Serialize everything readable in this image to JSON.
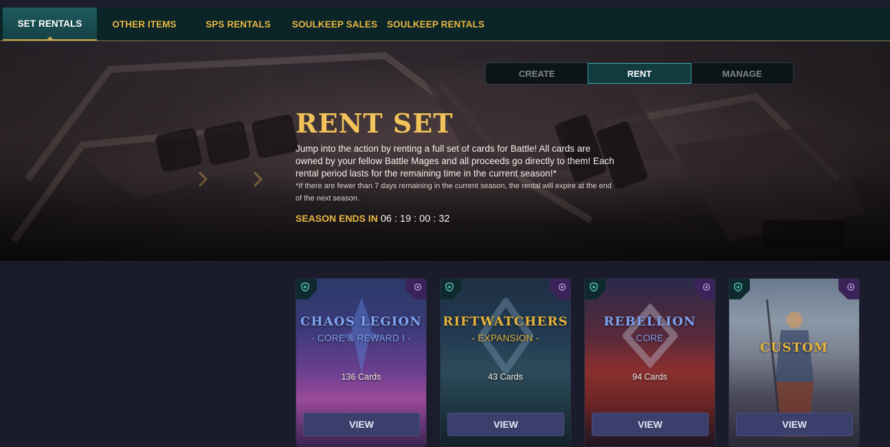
{
  "nav": {
    "tabs": [
      {
        "label": "SET RENTALS",
        "active": true
      },
      {
        "label": "OTHER ITEMS"
      },
      {
        "label": "SPS RENTALS"
      },
      {
        "label": "SOULKEEP SALES"
      },
      {
        "label": "SOULKEEP RENTALS"
      }
    ]
  },
  "mode_switch": {
    "options": [
      {
        "label": "CREATE"
      },
      {
        "label": "RENT",
        "active": true
      },
      {
        "label": "MANAGE"
      }
    ]
  },
  "hero": {
    "title": "RENT SET",
    "description": "Jump into the action by renting a full set of cards for Battle! All cards are owned by your fellow Battle Mages and all proceeds go directly to them! Each rental period lasts for the remaining time in the current season!*",
    "note": "*If there are fewer than 7 days remaining in the current season, the rental will expire at the end of the next season.",
    "season_label": "SEASON ENDS IN",
    "season_countdown": "06 : 19 : 00 : 32"
  },
  "sets": [
    {
      "title": "CHAOS LEGION",
      "subtitle": "- CORE & REWARD I -",
      "count": "136 Cards",
      "button": "VIEW",
      "title_color": "#7fa3f0",
      "icon_left": "shield-plus-icon",
      "icon_right": "gear-badge-icon"
    },
    {
      "title": "RIFTWATCHERS",
      "subtitle": "- EXPANSION -",
      "count": "43 Cards",
      "button": "VIEW",
      "title_color": "#e7b53e",
      "icon_left": "shield-plus-icon",
      "icon_right": "gear-badge-icon"
    },
    {
      "title": "REBELLION",
      "subtitle": "- CORE -",
      "count": "94 Cards",
      "button": "VIEW",
      "title_color": "#7fa3f0",
      "icon_left": "shield-plus-icon",
      "icon_right": "gear-badge-icon"
    },
    {
      "title": "CUSTOM",
      "subtitle": "",
      "count": "",
      "button": "VIEW",
      "title_color": "#e7b53e",
      "icon_left": "shield-plus-icon",
      "icon_right": "gear-badge-icon"
    }
  ],
  "colors": {
    "accent_gold": "#e9b842",
    "nav_bg": "#0a2427",
    "active_teal": "#1e5a5e",
    "button_bg": "#3b3f6c",
    "page_bg": "#1a1b2b"
  }
}
